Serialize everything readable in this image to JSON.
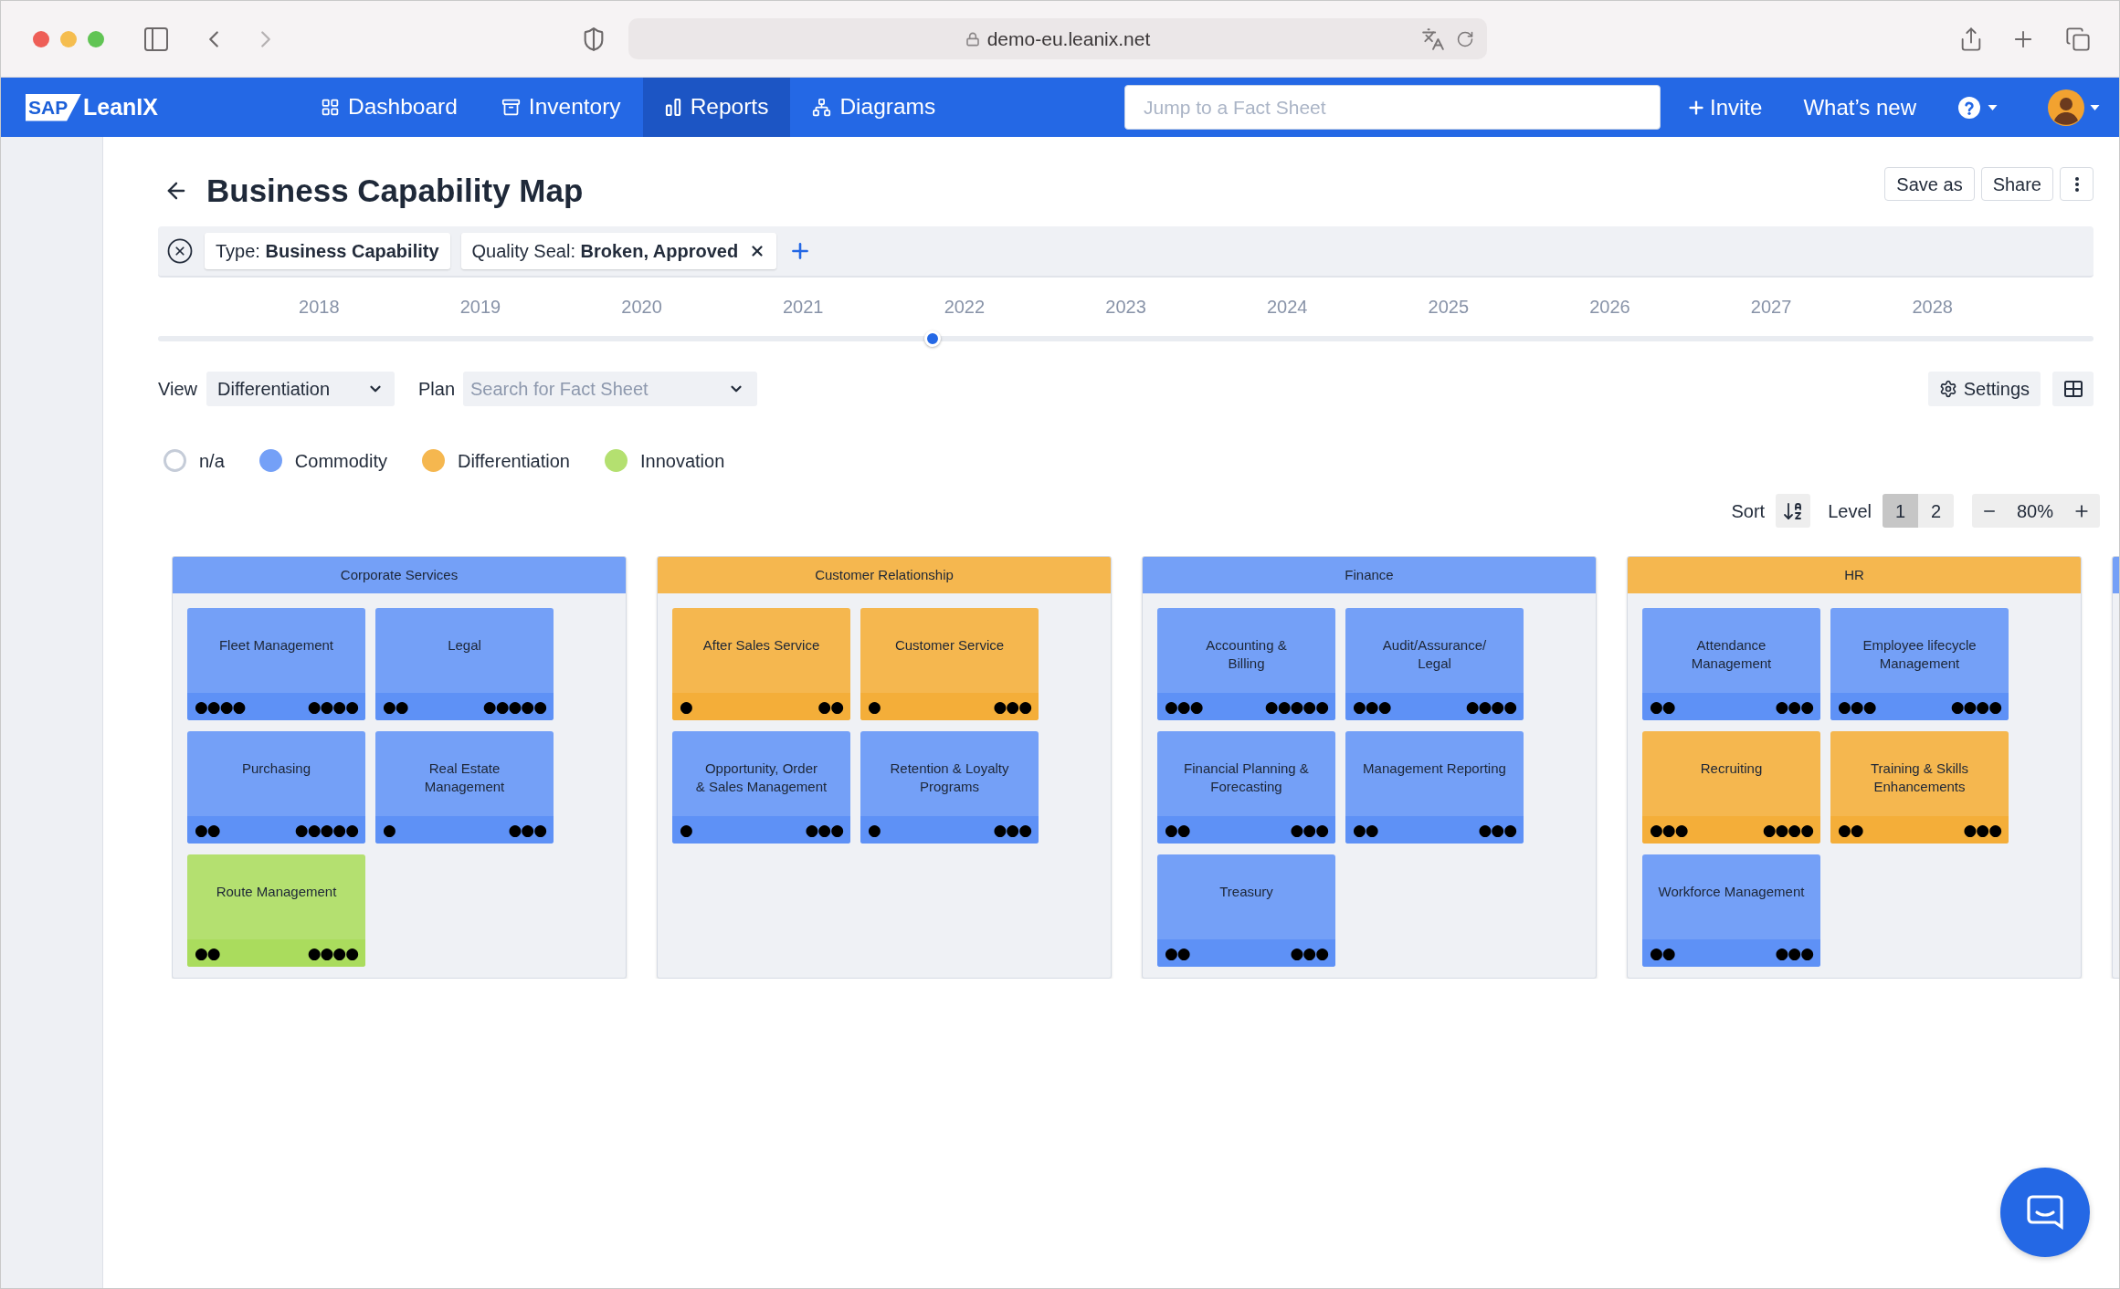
{
  "browser": {
    "url": "demo-eu.leanix.net"
  },
  "nav": {
    "logo_mark": "SAP",
    "logo_text": "LeanIX",
    "items": [
      {
        "label": "Dashboard",
        "kind": "dashboard",
        "selected": false
      },
      {
        "label": "Inventory",
        "kind": "inventory",
        "selected": false
      },
      {
        "label": "Reports",
        "kind": "reports",
        "selected": true
      },
      {
        "label": "Diagrams",
        "kind": "diagrams",
        "selected": false
      }
    ],
    "search": {
      "placeholder": "Jump to a Fact Sheet"
    },
    "invite": "Invite",
    "whats_new": "What’s new"
  },
  "page": {
    "title": "Business Capability Map",
    "buttons": [
      "Save as",
      "Share"
    ]
  },
  "filters": [
    {
      "text": "Type: **Business Capability**",
      "removable": false
    },
    {
      "text": "Quality Seal: **Broken, Approved**",
      "removable": true
    }
  ],
  "timeline": {
    "years": [
      "2018",
      "2019",
      "2020",
      "2021",
      "2022",
      "2023",
      "2024",
      "2025",
      "2026",
      "2027",
      "2028"
    ],
    "level": 0.4
  },
  "view": {
    "label": "View",
    "value": "Differentiation"
  },
  "plan": {
    "label": "Plan",
    "placeholder": "Search for Fact Sheet"
  },
  "settings": {
    "label": "Settings"
  },
  "legend": [
    {
      "label": "n/a",
      "kind": "hollow",
      "color": "#c5ccd8"
    },
    {
      "label": "Commodity",
      "kind": "filled",
      "color": "#74a0f7"
    },
    {
      "label": "Differentiation",
      "kind": "filled",
      "color": "#f5b74f"
    },
    {
      "label": "Innovation",
      "kind": "filled",
      "color": "#b4e070"
    }
  ],
  "sort": {
    "label": "Sort"
  },
  "level": {
    "label": "Level",
    "options": [
      {
        "label": "1",
        "selected": true
      },
      {
        "label": "2",
        "selected": false
      }
    ]
  },
  "zoom": {
    "value": "80%"
  },
  "columns": [
    {
      "title": "Corporate Services",
      "color": "#74a0f7",
      "cards": [
        {
          "name": "Fleet Management",
          "color": "#74a0f7",
          "indicators": [
            "●●●●",
            "●●●●"
          ]
        },
        {
          "name": "Legal",
          "color": "#74a0f7",
          "indicators": [
            "●●",
            "●●●●●"
          ]
        },
        {
          "name": "Purchasing",
          "color": "#74a0f7",
          "indicators": [
            "●●",
            "●●●●●"
          ]
        },
        {
          "name": "Real Estate\nManagement",
          "color": "#74a0f7",
          "indicators": [
            "●",
            "●●●"
          ]
        },
        {
          "name": "Route Management",
          "color": "#b4e070",
          "indicators": [
            "●●",
            "●●●●"
          ]
        }
      ]
    },
    {
      "title": "Customer Relationship",
      "color": "#f5b74f",
      "cards": [
        {
          "name": "After Sales Service",
          "color": "#f5b74f",
          "indicators": [
            "●",
            "●●"
          ]
        },
        {
          "name": "Customer Service",
          "color": "#f5b74f",
          "indicators": [
            "●",
            "●●●"
          ]
        },
        {
          "name": "Opportunity, Order\n& Sales Management",
          "color": "#74a0f7",
          "indicators": [
            "●",
            "●●●"
          ]
        },
        {
          "name": "Retention & Loyalty\nPrograms",
          "color": "#74a0f7",
          "indicators": [
            "●",
            "●●●"
          ]
        }
      ]
    },
    {
      "title": "Finance",
      "color": "#74a0f7",
      "cards": [
        {
          "name": "Accounting &\nBilling",
          "color": "#74a0f7",
          "indicators": [
            "●●●",
            "●●●●●"
          ]
        },
        {
          "name": "Audit/Assurance/\nLegal",
          "color": "#74a0f7",
          "indicators": [
            "●●●",
            "●●●●"
          ]
        },
        {
          "name": "Financial Planning &\nForecasting",
          "color": "#74a0f7",
          "indicators": [
            "●●",
            "●●●"
          ]
        },
        {
          "name": "Management Reporting",
          "color": "#74a0f7",
          "indicators": [
            "●●",
            "●●●"
          ]
        },
        {
          "name": "Treasury",
          "color": "#74a0f7",
          "indicators": [
            "●●",
            "●●●"
          ]
        }
      ]
    },
    {
      "title": "HR",
      "color": "#f5b74f",
      "cards": [
        {
          "name": "Attendance\nManagement",
          "color": "#74a0f7",
          "indicators": [
            "●●",
            "●●●"
          ]
        },
        {
          "name": "Employee lifecycle\nManagement",
          "color": "#74a0f7",
          "indicators": [
            "●●●",
            "●●●●"
          ]
        },
        {
          "name": "Recruiting",
          "color": "#f5b74f",
          "indicators": [
            "●●●",
            "●●●●"
          ]
        },
        {
          "name": "Training & Skills\nEnhancements",
          "color": "#f5b74f",
          "indicators": [
            "●●",
            "●●●"
          ]
        },
        {
          "name": "Workforce Management",
          "color": "#74a0f7",
          "indicators": [
            "●●",
            "●●●"
          ]
        }
      ]
    },
    {
      "color": "#74a0f7"
    }
  ]
}
